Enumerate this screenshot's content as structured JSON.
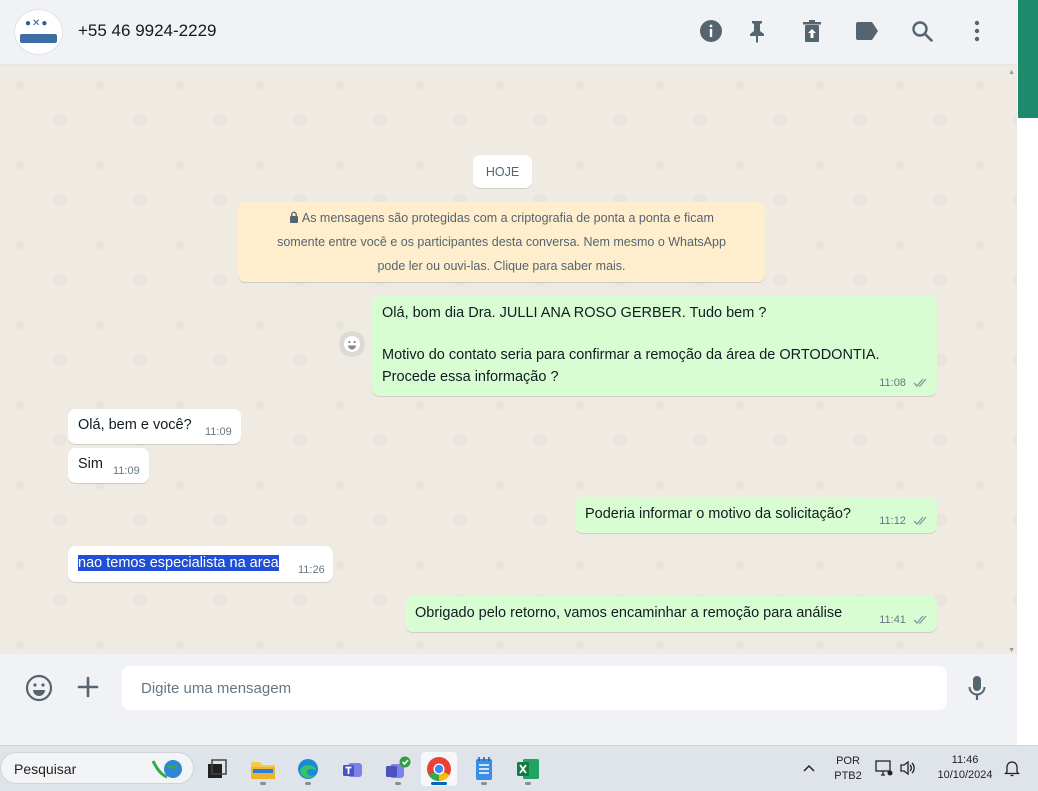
{
  "header": {
    "contact_name": "+55 46 9924-2229",
    "icons": [
      "info-icon",
      "pin-icon",
      "delete-icon",
      "label-icon",
      "search-icon",
      "menu-icon"
    ]
  },
  "chat": {
    "date_chip": "HOJE",
    "crypto_notice": {
      "line1": "As mensagens são protegidas com a criptografia de ponta a ponta e ficam",
      "line2": "somente entre você e os participantes desta conversa. Nem mesmo o WhatsApp",
      "line3": "pode ler ou ouvi-las. Clique para saber mais."
    },
    "messages": [
      {
        "dir": "out",
        "line1": "Olá, bom dia Dra. JULLI ANA ROSO GERBER. Tudo bem ?",
        "line2": "Motivo do contato seria para confirmar a remoção da área de ORTODONTIA.",
        "line3": "Procede essa informação ?",
        "time": "11:08"
      },
      {
        "dir": "in",
        "text": "Olá, bem e você?",
        "time": "11:09"
      },
      {
        "dir": "in",
        "text": "Sim",
        "time": "11:09"
      },
      {
        "dir": "out",
        "text": "Poderia informar o motivo da solicitação?",
        "time": "11:12"
      },
      {
        "dir": "in",
        "text": "nao temos especialista na area",
        "time": "11:26"
      },
      {
        "dir": "out",
        "text": "Obrigado pelo retorno, vamos encaminhar a remoção para análise",
        "time": "11:41"
      }
    ]
  },
  "composer": {
    "placeholder": "Digite uma mensagem"
  },
  "taskbar": {
    "search_label": "Pesquisar",
    "lang_line1": "POR",
    "lang_line2": "PTB2",
    "clock_time": "11:46",
    "clock_date": "10/10/2024"
  },
  "colors": {
    "outgoing_bubble": "#d9fdd3",
    "incoming_bubble": "#ffffff",
    "chat_background": "#efeae2",
    "accent": "#1d8a6c",
    "selection": "#1e4fd6"
  }
}
